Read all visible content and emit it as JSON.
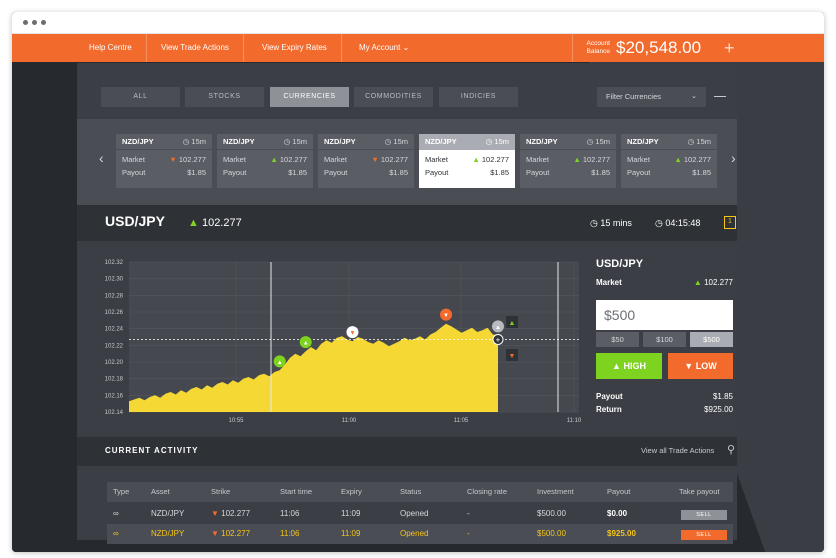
{
  "topnav": {
    "items": [
      "Help Centre",
      "View Trade Actions",
      "View Expiry Rates",
      "My Account"
    ],
    "account_chevron": "chevron-down-icon",
    "balance_label_line1": "Account",
    "balance_label_line2": "Balance",
    "balance_value": "$20,548.00",
    "plus_glyph": "+"
  },
  "filters": {
    "tabs": [
      "ALL",
      "STOCKS",
      "CURRENCIES",
      "COMMODITIES",
      "INDICIES"
    ],
    "active_tab": "CURRENCIES",
    "select_value": "Filter Currencies"
  },
  "tickers": [
    {
      "pair": "NZD/JPY",
      "time": "15m",
      "market_label": "Market",
      "market": "102.277",
      "trend": "down",
      "payout_label": "Payout",
      "payout": "$1.85"
    },
    {
      "pair": "NZD/JPY",
      "time": "15m",
      "market_label": "Market",
      "market": "102.277",
      "trend": "up",
      "payout_label": "Payout",
      "payout": "$1.85"
    },
    {
      "pair": "NZD/JPY",
      "time": "15m",
      "market_label": "Market",
      "market": "102.277",
      "trend": "down",
      "payout_label": "Payout",
      "payout": "$1.85"
    },
    {
      "pair": "NZD/JPY",
      "time": "15m",
      "market_label": "Market",
      "market": "102.277",
      "trend": "up",
      "payout_label": "Payout",
      "payout": "$1.85"
    },
    {
      "pair": "NZD/JPY",
      "time": "15m",
      "market_label": "Market",
      "market": "102.277",
      "trend": "up",
      "payout_label": "Payout",
      "payout": "$1.85"
    },
    {
      "pair": "NZD/JPY",
      "time": "15m",
      "market_label": "Market",
      "market": "102.277",
      "trend": "up",
      "payout_label": "Payout",
      "payout": "$1.85"
    }
  ],
  "selected_ticker_index": 3,
  "asset": {
    "pair": "USD/JPY",
    "value": "102.277",
    "duration": "15 mins",
    "clock": "04:15:48"
  },
  "chart_data": {
    "type": "area",
    "y_ticks": [
      "102.32",
      "102.30",
      "102.28",
      "102.26",
      "102.24",
      "102.22",
      "102.20",
      "102.18",
      "102.16",
      "102.14"
    ],
    "x_ticks": [
      "10:55",
      "11:00",
      "11:05",
      "11:10"
    ],
    "ylim": [
      102.14,
      102.32
    ],
    "current_level": 102.227,
    "series": [
      {
        "values": [
          102.153,
          102.155,
          102.157,
          102.154,
          102.158,
          102.16,
          102.157,
          102.162,
          102.164,
          102.161,
          102.166,
          102.163,
          102.168,
          102.17,
          102.167,
          102.172,
          102.169,
          102.174,
          102.176,
          102.173,
          102.178,
          102.175,
          102.18,
          102.182,
          102.179,
          102.184,
          102.186,
          102.183,
          102.188,
          102.19,
          102.197,
          102.205,
          102.21,
          102.207,
          102.213,
          102.218,
          102.214,
          102.222,
          102.226,
          102.223,
          102.229,
          102.231,
          102.227,
          102.225,
          102.23,
          102.228,
          102.224,
          102.222,
          102.226,
          102.223,
          102.219,
          102.222,
          102.225,
          102.229,
          102.226,
          102.228,
          102.231,
          102.227,
          102.233,
          102.236,
          102.241,
          102.246,
          102.243,
          102.239,
          102.235,
          102.238,
          102.241,
          102.236,
          102.238,
          102.241,
          102.233,
          102.232
        ]
      }
    ],
    "markers": [
      {
        "index": 29,
        "dir": "up"
      },
      {
        "index": 34,
        "dir": "up"
      },
      {
        "index": 43,
        "dir": "down"
      },
      {
        "index": 61,
        "dir": "down"
      },
      {
        "index": 71,
        "dir": "up"
      }
    ]
  },
  "trade": {
    "title": "USD/JPY",
    "market_label": "Market",
    "market_value": "102.277",
    "amount": "$500",
    "amount_options": [
      "$50",
      "$100",
      "$500"
    ],
    "selected_option": "$500",
    "high_label": "HIGH",
    "low_label": "LOW",
    "payout_label": "Payout",
    "payout_value": "$1.85",
    "return_label": "Return",
    "return_value": "$925.00"
  },
  "activity": {
    "title": "CURRENT ACTIVITY",
    "link": "View all Trade Actions",
    "columns": [
      "Type",
      "Asset",
      "Strike",
      "Start time",
      "Expiry",
      "Status",
      "Closing rate",
      "Investment",
      "Payout",
      "Take payout"
    ],
    "rows": [
      {
        "asset": "NZD/JPY",
        "strike": "102.277",
        "start": "11:06",
        "expiry": "11:09",
        "status": "Opened",
        "closing": "-",
        "investment": "$500.00",
        "payout": "$0.00",
        "action": "SELL"
      },
      {
        "asset": "NZD/JPY",
        "strike": "102.277",
        "start": "11:06",
        "expiry": "11:09",
        "status": "Opened",
        "closing": "-",
        "investment": "$500.00",
        "payout": "$925.00",
        "action": "SELL"
      }
    ]
  },
  "colors": {
    "accent": "#f26b2d",
    "up": "#7ed321",
    "down": "#f26b2d",
    "area": "#f5d833",
    "bg": "#2f3237"
  }
}
